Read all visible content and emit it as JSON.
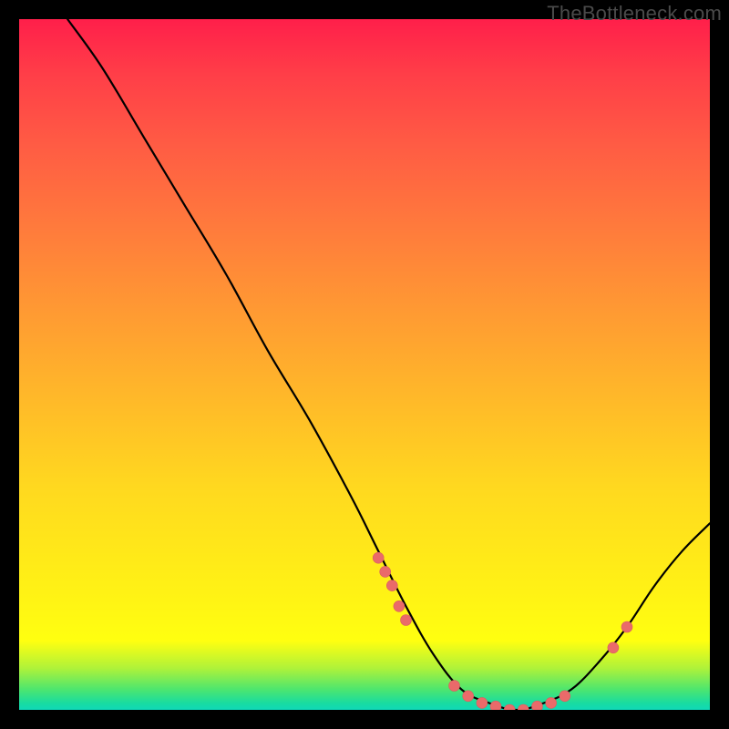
{
  "watermark": "TheBottleneck.com",
  "chart_data": {
    "type": "line",
    "title": "",
    "xlabel": "",
    "ylabel": "",
    "xlim": [
      0,
      1
    ],
    "ylim": [
      0,
      1
    ],
    "grid": false,
    "background_gradient": {
      "top_color": "#ff1f4a",
      "bottom_color": "#10d8b8",
      "description": "vertical red-to-green gradient (higher y = worse / red, lower y = better / green)"
    },
    "series": [
      {
        "name": "bottleneck-curve",
        "stroke": "#000000",
        "x": [
          0.07,
          0.12,
          0.18,
          0.24,
          0.3,
          0.36,
          0.42,
          0.48,
          0.52,
          0.56,
          0.6,
          0.64,
          0.68,
          0.72,
          0.76,
          0.8,
          0.84,
          0.88,
          0.92,
          0.96,
          1.0
        ],
        "y": [
          1.0,
          0.93,
          0.83,
          0.73,
          0.63,
          0.52,
          0.42,
          0.31,
          0.23,
          0.15,
          0.08,
          0.03,
          0.01,
          0.0,
          0.01,
          0.03,
          0.07,
          0.12,
          0.18,
          0.23,
          0.27
        ]
      }
    ],
    "markers": {
      "description": "highlighted sample points on the curve, rendered as small salmon circles",
      "color": "#ea6a6a",
      "radius_px": 6,
      "points": [
        {
          "x": 0.52,
          "y": 0.22
        },
        {
          "x": 0.53,
          "y": 0.2
        },
        {
          "x": 0.54,
          "y": 0.18
        },
        {
          "x": 0.55,
          "y": 0.15
        },
        {
          "x": 0.56,
          "y": 0.13
        },
        {
          "x": 0.63,
          "y": 0.035
        },
        {
          "x": 0.65,
          "y": 0.02
        },
        {
          "x": 0.67,
          "y": 0.01
        },
        {
          "x": 0.69,
          "y": 0.005
        },
        {
          "x": 0.71,
          "y": 0.0
        },
        {
          "x": 0.73,
          "y": 0.0
        },
        {
          "x": 0.75,
          "y": 0.005
        },
        {
          "x": 0.77,
          "y": 0.01
        },
        {
          "x": 0.79,
          "y": 0.02
        },
        {
          "x": 0.86,
          "y": 0.09
        },
        {
          "x": 0.88,
          "y": 0.12
        }
      ]
    }
  }
}
